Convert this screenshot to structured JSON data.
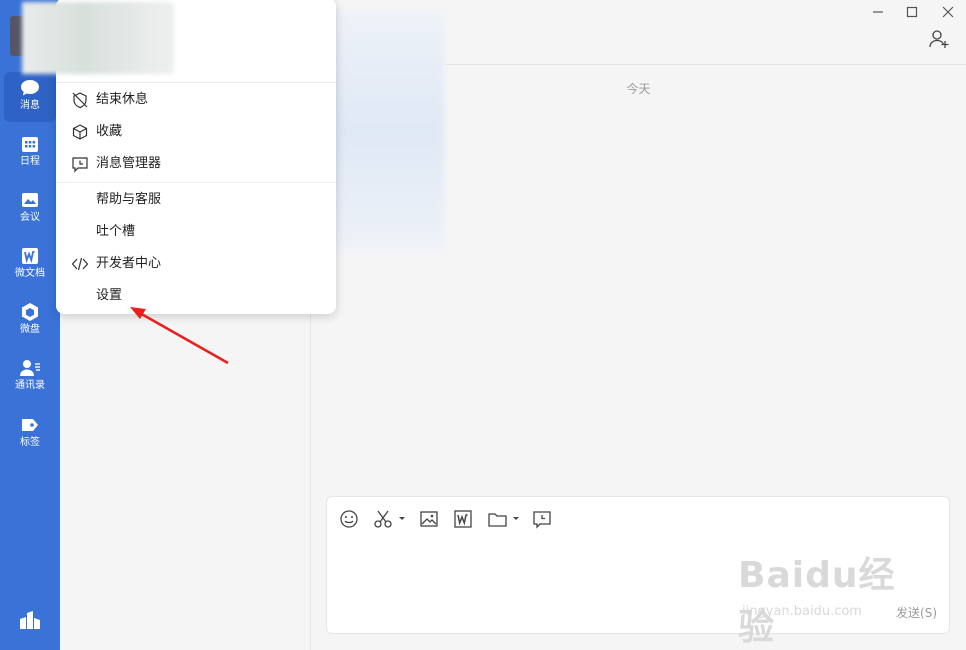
{
  "nav": {
    "items": [
      {
        "label": "消息",
        "icon": "chat-bubble-icon"
      },
      {
        "label": "日程",
        "icon": "calendar-icon"
      },
      {
        "label": "会议",
        "icon": "meeting-icon"
      },
      {
        "label": "微文档",
        "icon": "doc-icon"
      },
      {
        "label": "微盘",
        "icon": "drive-icon"
      },
      {
        "label": "通讯录",
        "icon": "contacts-icon"
      },
      {
        "label": "标签",
        "icon": "tag-icon"
      }
    ],
    "accent": "#3a72d8"
  },
  "menu": {
    "items": [
      {
        "label": "结束休息",
        "icon": "rest-end-icon"
      },
      {
        "label": "收藏",
        "icon": "cube-icon"
      },
      {
        "label": "消息管理器",
        "icon": "message-manager-icon"
      },
      {
        "label": "帮助与客服",
        "icon": ""
      },
      {
        "label": "吐个槽",
        "icon": ""
      },
      {
        "label": "开发者中心",
        "icon": "code-icon"
      },
      {
        "label": "设置",
        "icon": ""
      }
    ]
  },
  "chat": {
    "date": "今天",
    "send_label": "发送(S)"
  },
  "watermark": {
    "brand": "Baidu经验",
    "url": "jingyan.baidu.com"
  },
  "annotation_color": "#e8201c"
}
